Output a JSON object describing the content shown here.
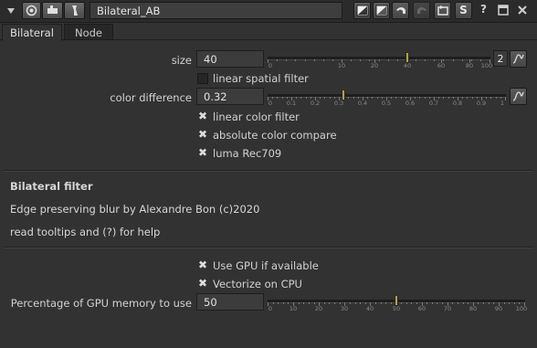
{
  "titlebar": {
    "node_name": "Bilateral_AB",
    "help_glyph": "?",
    "s_glyph": "S"
  },
  "tabs": [
    {
      "label": "Bilateral"
    },
    {
      "label": "Node"
    }
  ],
  "knobs": {
    "size": {
      "label": "size",
      "value": "40",
      "tick_labels": [
        "0",
        "10",
        "20",
        "40",
        "60",
        "80",
        "100"
      ],
      "tick_values": [
        0,
        10,
        20,
        40,
        60,
        80,
        100
      ],
      "handle_value": 40,
      "channels": "2"
    },
    "linear_spatial_filter": {
      "label": "linear spatial filter",
      "checked": false
    },
    "color_difference": {
      "label": "color difference",
      "value": "0.32",
      "tick_labels": [
        "0",
        "0.1",
        "0.2",
        "0.3",
        "0.4",
        "0.5",
        "0.6",
        "0.7",
        "0.8",
        "0.9",
        "1"
      ],
      "handle_value": 0.32
    },
    "linear_color_filter": {
      "label": "linear color filter",
      "checked": true
    },
    "absolute_color_compare": {
      "label": "absolute color compare",
      "checked": true
    },
    "luma_rec709": {
      "label": "luma Rec709",
      "checked": true
    },
    "use_gpu": {
      "label": "Use GPU if available",
      "checked": true
    },
    "vectorize_cpu": {
      "label": "Vectorize on CPU",
      "checked": true
    },
    "gpu_memory": {
      "label": "Percentage of GPU memory to use",
      "value": "50",
      "tick_labels": [
        "0",
        "10",
        "20",
        "30",
        "40",
        "50",
        "60",
        "70",
        "80",
        "90",
        "100"
      ],
      "handle_value": 50
    }
  },
  "info": {
    "heading": "Bilateral filter",
    "description": "Edge preserving blur by Alexandre Bon (c)2020",
    "help": "read tooltips and (?) for help"
  },
  "colors": {
    "background": "#323232",
    "handle": "#b5a04a",
    "text": "#d6d6d6"
  }
}
